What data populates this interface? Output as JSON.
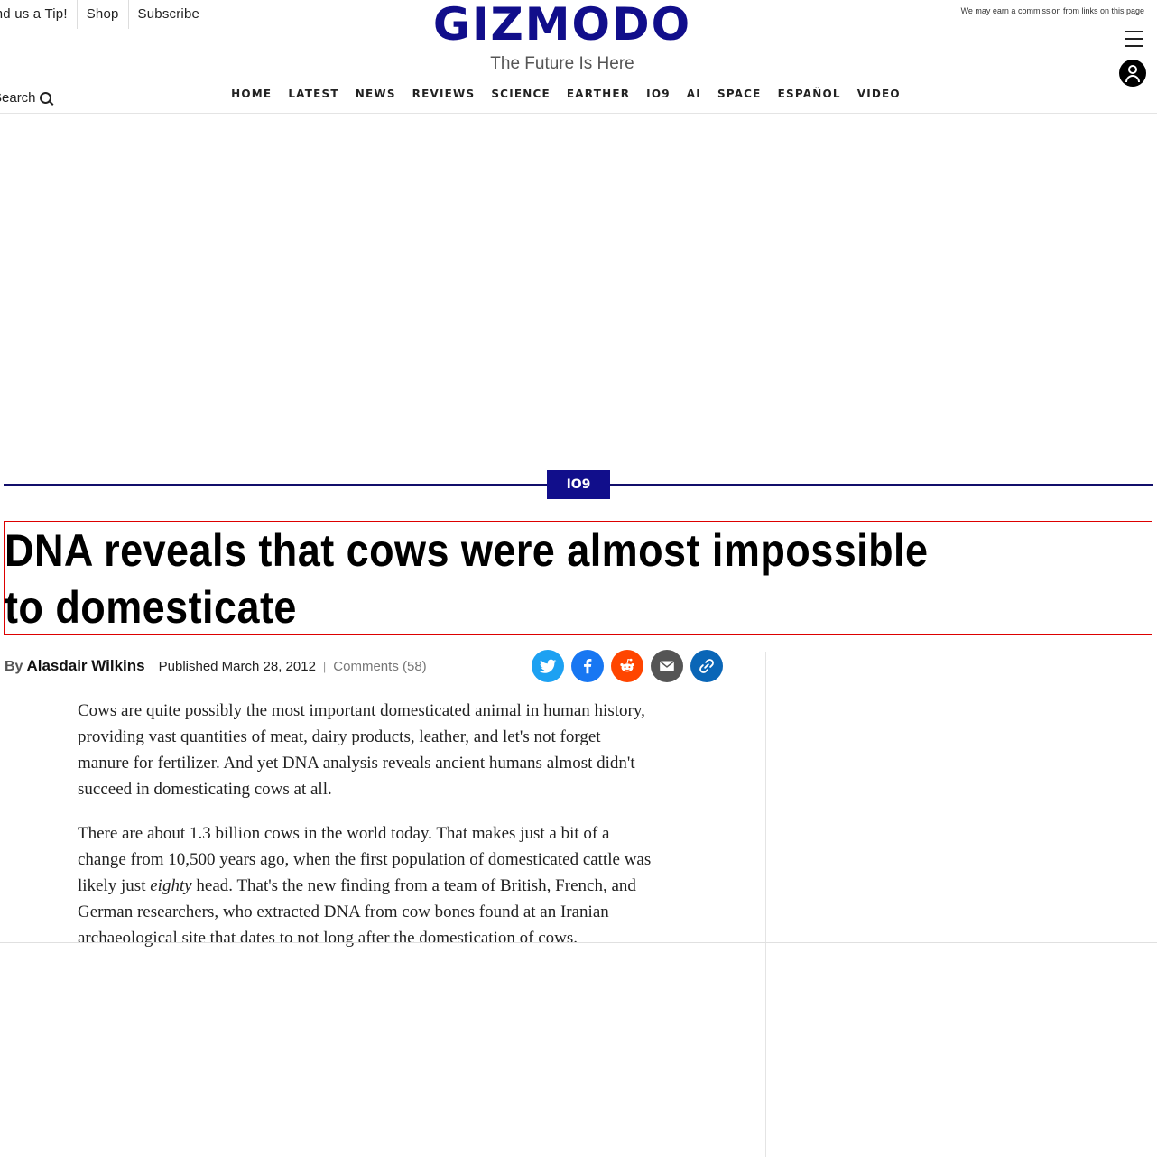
{
  "topbar": {
    "tip": "Send us a Tip!",
    "shop": "Shop",
    "subscribe": "Subscribe"
  },
  "brand": {
    "logo": "GIZMODO",
    "tagline": "The Future Is Here",
    "color": "#110e8b"
  },
  "commission_note": "We may earn a commission from links on this page",
  "search_label": "Search",
  "nav": [
    "HOME",
    "LATEST",
    "NEWS",
    "REVIEWS",
    "SCIENCE",
    "EARTHER",
    "IO9",
    "AI",
    "SPACE",
    "ESPAÑOL",
    "VIDEO"
  ],
  "article": {
    "section": "IO9",
    "headline": "DNA reveals that cows were almost impossible to domesticate",
    "by_label": "By",
    "author": "Alasdair Wilkins",
    "published": "Published March 28, 2012",
    "separator": "|",
    "comments": "Comments (58)",
    "paragraphs": [
      "Cows are quite possibly the most important domesticated animal in human history, providing vast quantities of meat, dairy products, leather, and let's not forget manure for fertilizer. And yet DNA analysis reveals ancient humans almost didn't succeed in domesticating cows at all.",
      {
        "before": "There are about 1.3 billion cows in the world today. That makes just a bit of a change from 10,500 years ago, when the first population of domesticated cattle was likely just ",
        "emphasis": "eighty",
        "after": " head. That's the new finding from a team of British, French, and German researchers, who extracted DNA from cow bones found at an Iranian archaeological site that dates to not long after the domestication of cows."
      }
    ]
  },
  "share": [
    {
      "icon": "twitter-icon",
      "color": "#1da1f2"
    },
    {
      "icon": "facebook-icon",
      "color": "#1877f2"
    },
    {
      "icon": "reddit-icon",
      "color": "#ff4500"
    },
    {
      "icon": "email-icon",
      "color": "#555555"
    },
    {
      "icon": "link-icon",
      "color": "#0a66b7"
    }
  ]
}
